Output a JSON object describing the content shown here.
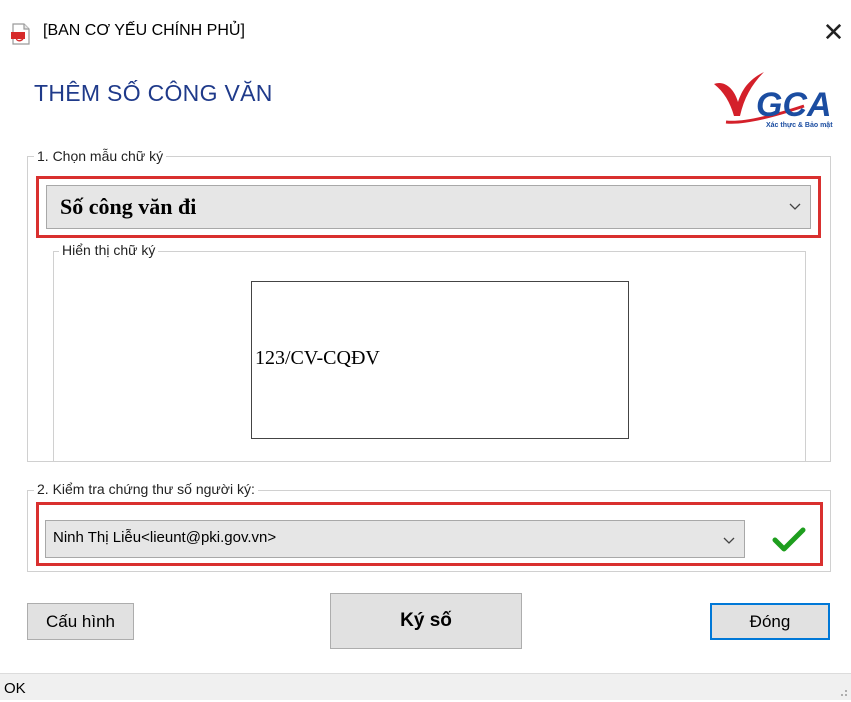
{
  "window": {
    "title": "[BAN CƠ YẾU CHÍNH PHỦ]",
    "close_glyph": "✕",
    "icon": "pdf-file-icon"
  },
  "header": {
    "title": "THÊM SỐ CÔNG VĂN",
    "logo_text": "GCA",
    "logo_tagline": "Xác thực & Bảo mật"
  },
  "section1": {
    "legend": "1. Chọn mẫu chữ ký",
    "selected_template": "Số công văn đi",
    "preview": {
      "legend": "Hiển thị chữ ký",
      "signature_text": "123/CV-CQĐV"
    }
  },
  "section2": {
    "legend": "2. Kiểm tra chứng thư số người ký:",
    "selected_signer": "Ninh Thị Liễu<lieunt@pki.gov.vn>",
    "status_icon": "green-checkmark-icon"
  },
  "buttons": {
    "config": "Cấu hình",
    "sign": "Ký số",
    "close": "Đóng"
  },
  "status": {
    "text": "OK"
  },
  "colors": {
    "heading": "#1f3a8a",
    "highlight_border": "#d9302f",
    "check": "#1e9e1e",
    "logo_red": "#d4202a",
    "logo_blue": "#1b4da1",
    "focus_border": "#0078d7"
  }
}
